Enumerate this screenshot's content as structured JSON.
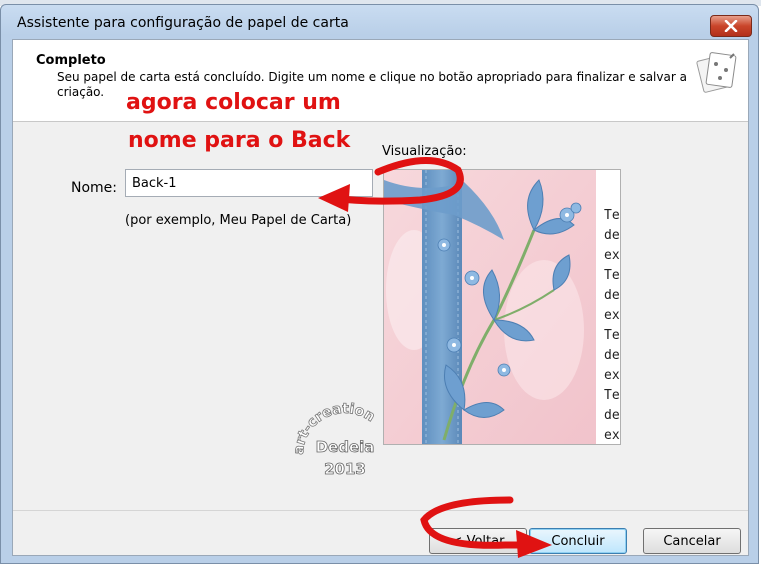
{
  "window": {
    "title": "Assistente para configuração de papel de carta",
    "close_icon": "close-icon"
  },
  "header": {
    "title": "Completo",
    "description": "Seu papel de carta está concluído. Digite um nome e clique no botão apropriado para finalizar e salvar a criação.",
    "icon": "stationery-wizard-icon"
  },
  "form": {
    "name_label": "Nome:",
    "name_value": "Back-1",
    "example": "(por exemplo, Meu Papel de Carta)"
  },
  "preview": {
    "label": "Visualização:",
    "sample_text": [
      "Te",
      "de",
      "ex",
      "Te",
      "de",
      "ex",
      "Te",
      "de",
      "ex",
      "Te",
      "de",
      "ex"
    ]
  },
  "buttons": {
    "back": "< Voltar",
    "finish": "Concluir",
    "cancel": "Cancelar"
  },
  "annotations": {
    "line1": "agora colocar um",
    "line2": "nome para o Back"
  },
  "watermark": {
    "ring_text": "art-creation",
    "name": "Dedeia",
    "year": "2013"
  },
  "colors": {
    "annotation": "#e01212",
    "close_button": "#c9452a",
    "flower_blue": "#6e9fd0",
    "preview_pink": "#f3c9cf"
  }
}
